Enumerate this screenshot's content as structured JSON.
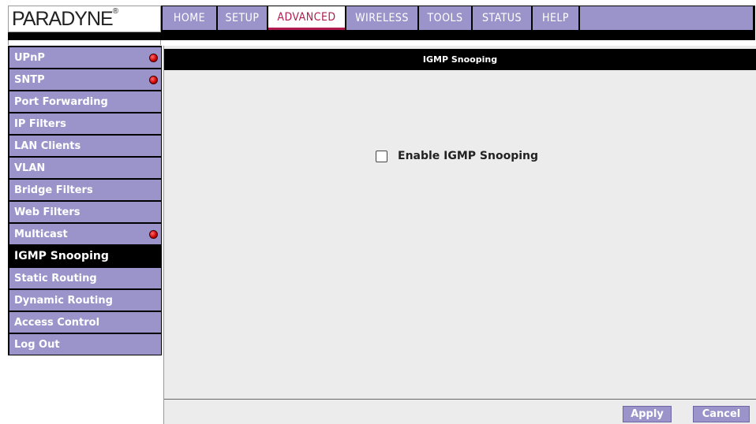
{
  "brand": {
    "logo_text": "PARADYNE",
    "logo_mark": "®"
  },
  "topnav": {
    "tabs": [
      {
        "label": "HOME"
      },
      {
        "label": "SETUP"
      },
      {
        "label": "ADVANCED",
        "active": true
      },
      {
        "label": "WIRELESS"
      },
      {
        "label": "TOOLS"
      },
      {
        "label": "STATUS"
      },
      {
        "label": "HELP"
      }
    ]
  },
  "sidebar": {
    "items": [
      {
        "label": "UPnP",
        "indicator": "red-dot"
      },
      {
        "label": "SNTP",
        "indicator": "red-dot"
      },
      {
        "label": "Port Forwarding"
      },
      {
        "label": "IP Filters"
      },
      {
        "label": "LAN Clients"
      },
      {
        "label": "VLAN"
      },
      {
        "label": "Bridge Filters"
      },
      {
        "label": "Web Filters"
      },
      {
        "label": "Multicast",
        "indicator": "red-dot"
      },
      {
        "label": "IGMP Snooping",
        "active": true
      },
      {
        "label": "Static Routing"
      },
      {
        "label": "Dynamic Routing"
      },
      {
        "label": "Access Control"
      },
      {
        "label": "Log Out"
      }
    ]
  },
  "main": {
    "title": "IGMP Snooping",
    "enable_label": "Enable IGMP Snooping",
    "enable_checked": false
  },
  "buttons": {
    "apply": "Apply",
    "cancel": "Cancel"
  },
  "colors": {
    "nav_bg": "#9a94cb",
    "active_accent": "#b01a4e",
    "panel_bg": "#ececec",
    "header_bg": "#000000"
  }
}
